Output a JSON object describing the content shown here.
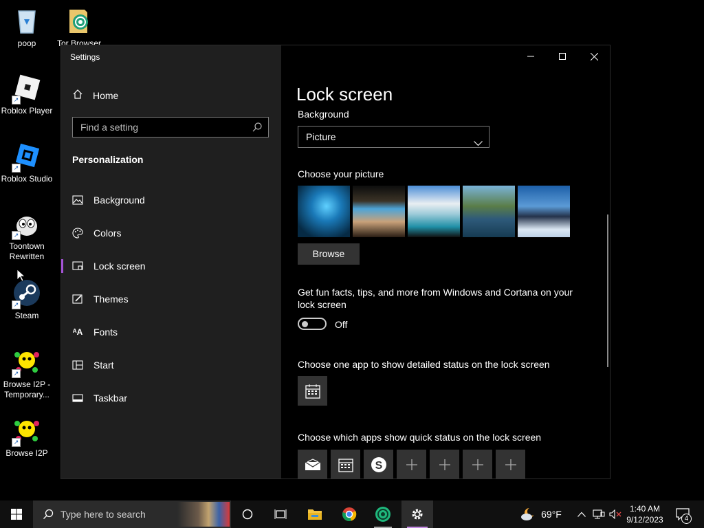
{
  "desktop": {
    "icons": [
      {
        "label": "poop"
      },
      {
        "label": "Roblox Player"
      },
      {
        "label": "Roblox Studio"
      },
      {
        "label": "Toontown Rewritten"
      },
      {
        "label": "Steam"
      },
      {
        "label": "Browse I2P - Temporary..."
      },
      {
        "label": "Browse I2P"
      }
    ],
    "partial_icon_label": "Tor Browser"
  },
  "window": {
    "title": "Settings",
    "home_label": "Home",
    "search_placeholder": "Find a setting",
    "section": "Personalization",
    "nav": [
      {
        "label": "Background",
        "icon": "picture-icon"
      },
      {
        "label": "Colors",
        "icon": "palette-icon"
      },
      {
        "label": "Lock screen",
        "icon": "lock-screen-icon",
        "active": true
      },
      {
        "label": "Themes",
        "icon": "brush-icon"
      },
      {
        "label": "Fonts",
        "icon": "font-icon"
      },
      {
        "label": "Start",
        "icon": "start-grid-icon"
      },
      {
        "label": "Taskbar",
        "icon": "taskbar-icon"
      }
    ]
  },
  "content": {
    "title": "Lock screen",
    "background_label": "Background",
    "background_value": "Picture",
    "choose_picture_label": "Choose your picture",
    "browse_label": "Browse",
    "fun_facts_label": "Get fun facts, tips, and more from Windows and Cortana on your lock screen",
    "toggle_state": "Off",
    "detailed_status_label": "Choose one app to show detailed status on the lock screen",
    "quick_status_label": "Choose which apps show quick status on the lock screen"
  },
  "taskbar": {
    "search_placeholder": "Type here to search",
    "weather": "69°F",
    "time": "1:40 AM",
    "date": "9/12/2023",
    "notifications": "4"
  },
  "colors": {
    "accent": "#a453d6",
    "sidebar": "#1f1f1f",
    "taskbar": "#101010"
  }
}
